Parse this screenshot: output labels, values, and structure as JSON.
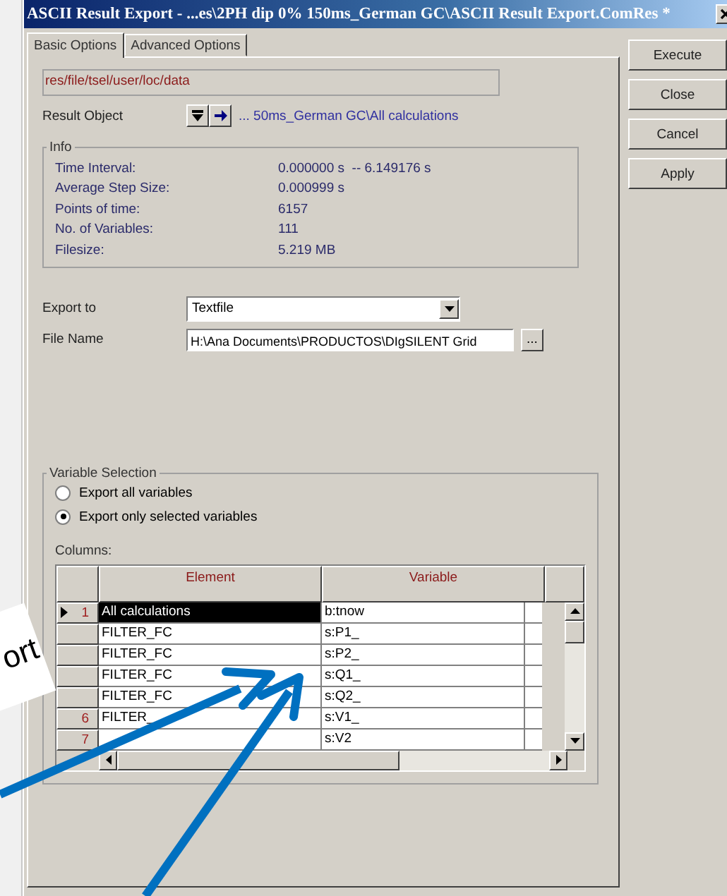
{
  "window": {
    "title": "ASCII Result Export - ...es\\2PH dip 0% 150ms_German GC\\ASCII Result Export.ComRes *"
  },
  "tabs": [
    {
      "label": "Basic Options",
      "selected": true
    },
    {
      "label": "Advanced Options",
      "selected": false
    }
  ],
  "path_field": {
    "value": "res/file/tsel/user/loc/data"
  },
  "result_object": {
    "label": "Result Object",
    "value": "... 50ms_German GC\\All calculations"
  },
  "info": {
    "title": "Info",
    "rows": [
      {
        "label": "Time Interval:",
        "value": "0.000000 s  -- 6.149176 s"
      },
      {
        "label": "Average Step Size:",
        "value": "0.000999 s"
      },
      {
        "label": "Points of time:",
        "value": "6157"
      },
      {
        "label": "No. of Variables:",
        "value": "111"
      },
      {
        "label": "Filesize:",
        "value": "5.219 MB"
      }
    ]
  },
  "export_to": {
    "label": "Export to",
    "value": "Textfile"
  },
  "file_name": {
    "label": "File Name",
    "value": "H:\\Ana Documents\\PRODUCTOS\\DIgSILENT Grid",
    "browse": "..."
  },
  "variable_selection": {
    "title": "Variable Selection",
    "options": [
      {
        "label": "Export all variables",
        "selected": false
      },
      {
        "label": "Export only selected variables",
        "selected": true
      }
    ],
    "columns_label": "Columns:",
    "table": {
      "columns": [
        "Element",
        "Variable"
      ],
      "rows": [
        {
          "number": "1",
          "element": "All calculations",
          "variable": "b:tnow",
          "selected": true
        },
        {
          "element": "FILTER_FC",
          "variable": "s:P1_",
          "selected": false
        },
        {
          "element": "FILTER_FC",
          "variable": "s:P2_",
          "selected": false
        },
        {
          "element": "FILTER_FC",
          "variable": "s:Q1_",
          "selected": false
        },
        {
          "element": "FILTER_FC",
          "variable": "s:Q2_",
          "selected": false
        },
        {
          "number": "6",
          "element": "FILTER_",
          "variable": "s:V1_",
          "selected": false
        },
        {
          "number": "7",
          "variable": "s:V2",
          "selected": false
        }
      ]
    }
  },
  "buttons": [
    "Execute",
    "Close",
    "Cancel",
    "Apply"
  ],
  "annotation": {
    "text": "ort"
  }
}
